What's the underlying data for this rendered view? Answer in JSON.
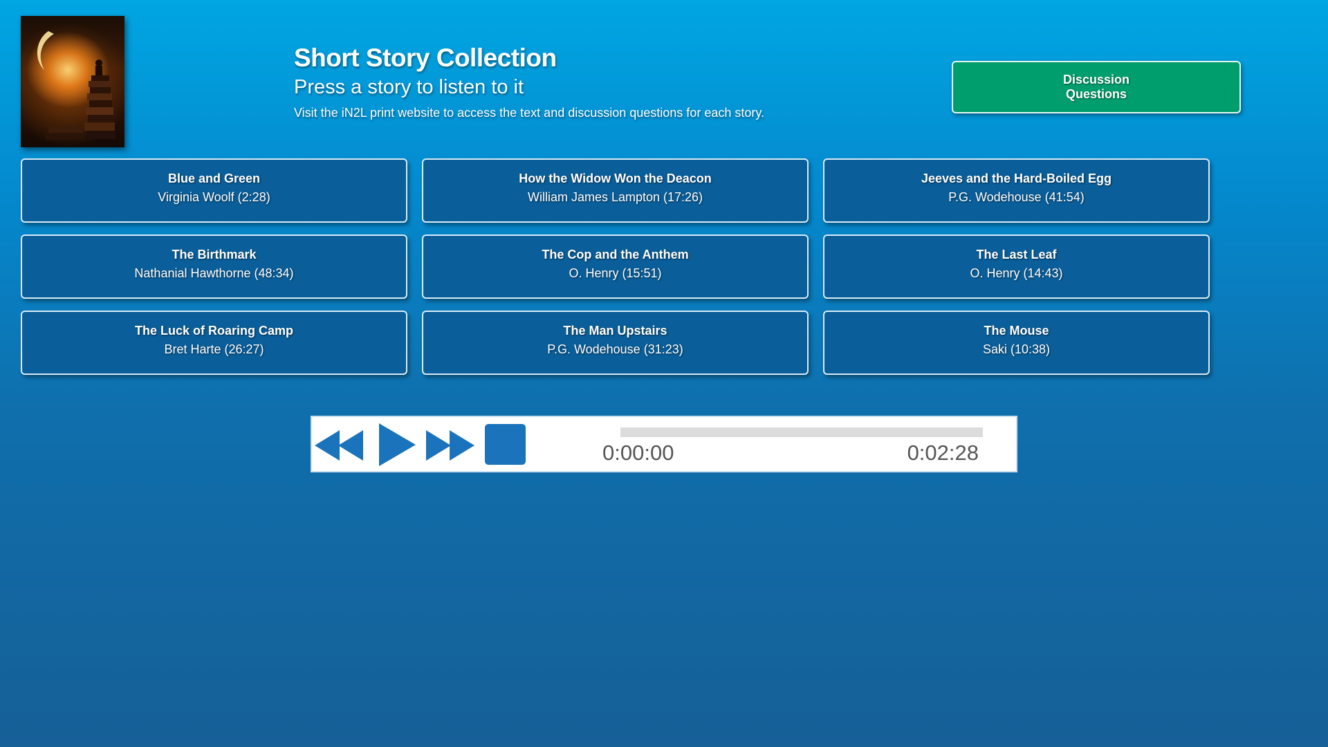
{
  "header": {
    "cover_icon": "book-stack-moon-icon",
    "title": "Short Story Collection",
    "subtitle": "Press a story to listen to it",
    "note": "Visit the iN2L print website to access the text and discussion questions for each story.",
    "discussion_button": "Discussion\nQuestions"
  },
  "stories": [
    {
      "title": "Blue and Green",
      "author": "Virginia Woolf (2:28)"
    },
    {
      "title": "How the Widow Won the Deacon",
      "author": "William James Lampton (17:26)"
    },
    {
      "title": "Jeeves and the Hard-Boiled Egg",
      "author": "P.G. Wodehouse (41:54)"
    },
    {
      "title": "The Birthmark",
      "author": "Nathanial Hawthorne (48:34)"
    },
    {
      "title": "The Cop and the Anthem",
      "author": "O. Henry (15:51)"
    },
    {
      "title": "The Last Leaf",
      "author": "O. Henry (14:43)"
    },
    {
      "title": "The Luck of Roaring Camp",
      "author": "Bret Harte (26:27)"
    },
    {
      "title": "The Man Upstairs",
      "author": "P.G. Wodehouse (31:23)"
    },
    {
      "title": "The Mouse",
      "author": "Saki (10:38)"
    }
  ],
  "player": {
    "controls": [
      "rewind-icon",
      "play-icon",
      "fast-forward-icon",
      "stop-icon"
    ],
    "current_time": "0:00:00",
    "total_time": "0:02:28",
    "progress": 0,
    "control_color": "#1a73bb"
  },
  "colors": {
    "accent": "#009e6c",
    "card_background": "#0a5e99",
    "background_top": "#00a6e2",
    "background_bottom": "#165f97"
  }
}
